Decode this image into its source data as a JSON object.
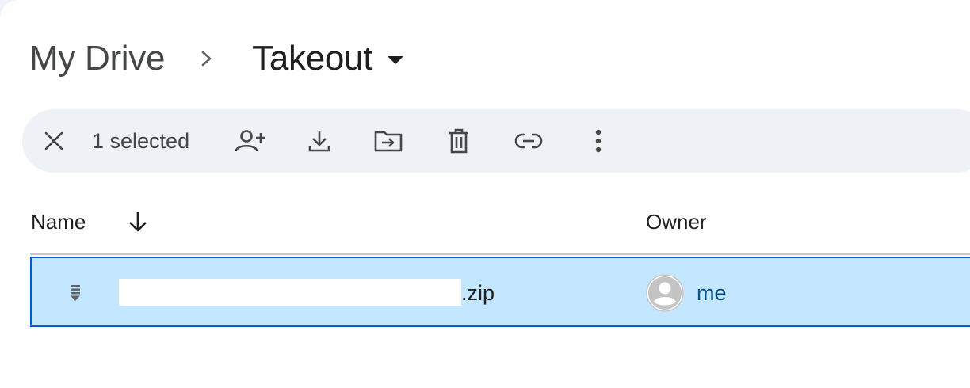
{
  "breadcrumb": {
    "root": "My Drive",
    "current": "Takeout"
  },
  "toolbar": {
    "selected_label": "1 selected",
    "actions": [
      "close",
      "share",
      "download",
      "move",
      "delete",
      "copy-link",
      "more"
    ]
  },
  "table": {
    "columns": [
      "Name",
      "Owner"
    ],
    "sort_direction": "descending",
    "rows": [
      {
        "file_extension": ".zip",
        "owner": "me",
        "selected": true
      }
    ]
  },
  "colors": {
    "selection_bg": "#c2e7ff",
    "selection_border": "#0b57d0",
    "toolbar_bg": "#eef2f7",
    "owner_text": "#0b4f82"
  },
  "icons": {
    "breadcrumb_separator": "chevron-right-icon",
    "breadcrumb_menu": "caret-down-icon",
    "sort": "arrow-down-icon",
    "file_type": "archive-icon",
    "owner": "avatar-icon"
  }
}
